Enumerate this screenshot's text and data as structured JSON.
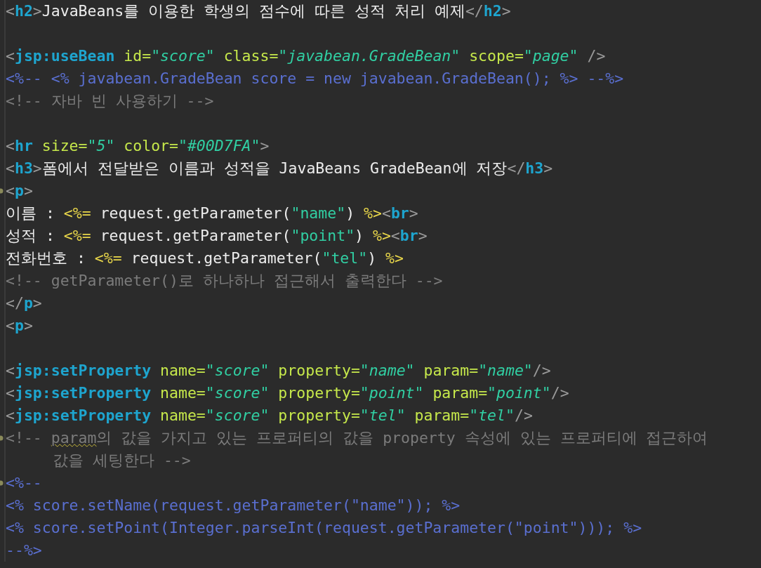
{
  "editor": {
    "lines": [
      {
        "kind": "code",
        "fold": false,
        "tokens": [
          {
            "text": "<",
            "kind": "p"
          },
          {
            "text": "h2",
            "kind": "tag"
          },
          {
            "text": ">",
            "kind": "p"
          },
          {
            "text": "JavaBeans를 이용한 학생의 점수에 따른 성적 처리 예제",
            "kind": "text"
          },
          {
            "text": "</",
            "kind": "p"
          },
          {
            "text": "h2",
            "kind": "tag"
          },
          {
            "text": ">",
            "kind": "p"
          }
        ]
      },
      {
        "kind": "blank"
      },
      {
        "kind": "code",
        "fold": false,
        "tokens": [
          {
            "text": "<",
            "kind": "p"
          },
          {
            "text": "jsp:useBean",
            "kind": "tag"
          },
          {
            "text": " id=",
            "kind": "attr"
          },
          {
            "text": "\"score\"",
            "kind": "val"
          },
          {
            "text": " class=",
            "kind": "attr"
          },
          {
            "text": "\"javabean.GradeBean\"",
            "kind": "val"
          },
          {
            "text": " scope=",
            "kind": "attr"
          },
          {
            "text": "\"page\"",
            "kind": "val"
          },
          {
            "text": " />",
            "kind": "p"
          }
        ]
      },
      {
        "kind": "code",
        "fold": false,
        "tokens": [
          {
            "text": "<%-- <% javabean.GradeBean score = new javabean.GradeBean(); %> --%>",
            "kind": "jspc"
          }
        ]
      },
      {
        "kind": "code",
        "fold": false,
        "tokens": [
          {
            "text": "<!-- 자바 빈 사용하기 -->",
            "kind": "cmt"
          }
        ]
      },
      {
        "kind": "blank"
      },
      {
        "kind": "code",
        "fold": false,
        "tokens": [
          {
            "text": "<",
            "kind": "p"
          },
          {
            "text": "hr",
            "kind": "tag"
          },
          {
            "text": " size=",
            "kind": "attr"
          },
          {
            "text": "\"5\"",
            "kind": "val"
          },
          {
            "text": " color=",
            "kind": "attr"
          },
          {
            "text": "\"#00D7FA\"",
            "kind": "val"
          },
          {
            "text": ">",
            "kind": "p"
          }
        ]
      },
      {
        "kind": "code",
        "fold": false,
        "tokens": [
          {
            "text": "<",
            "kind": "p"
          },
          {
            "text": "h3",
            "kind": "tag"
          },
          {
            "text": ">",
            "kind": "p"
          },
          {
            "text": "폼에서 전달받은 이름과 성적을 JavaBeans GradeBean에 저장",
            "kind": "text"
          },
          {
            "text": "</",
            "kind": "p"
          },
          {
            "text": "h3",
            "kind": "tag"
          },
          {
            "text": ">",
            "kind": "p"
          }
        ]
      },
      {
        "kind": "code",
        "fold": true,
        "tokens": [
          {
            "text": "<",
            "kind": "p"
          },
          {
            "text": "p",
            "kind": "tag"
          },
          {
            "text": ">",
            "kind": "p"
          }
        ]
      },
      {
        "kind": "code",
        "fold": false,
        "tokens": [
          {
            "text": "이름 : ",
            "kind": "text"
          },
          {
            "text": "<%=",
            "kind": "scr"
          },
          {
            "text": " request.getParameter(",
            "kind": "text"
          },
          {
            "text": "\"name\"",
            "kind": "str"
          },
          {
            "text": ") ",
            "kind": "text"
          },
          {
            "text": "%>",
            "kind": "scr"
          },
          {
            "text": "<",
            "kind": "p"
          },
          {
            "text": "br",
            "kind": "tag"
          },
          {
            "text": ">",
            "kind": "p"
          }
        ]
      },
      {
        "kind": "code",
        "fold": false,
        "tokens": [
          {
            "text": "성적 : ",
            "kind": "text"
          },
          {
            "text": "<%=",
            "kind": "scr"
          },
          {
            "text": " request.getParameter(",
            "kind": "text"
          },
          {
            "text": "\"point\"",
            "kind": "str"
          },
          {
            "text": ") ",
            "kind": "text"
          },
          {
            "text": "%>",
            "kind": "scr"
          },
          {
            "text": "<",
            "kind": "p"
          },
          {
            "text": "br",
            "kind": "tag"
          },
          {
            "text": ">",
            "kind": "p"
          }
        ]
      },
      {
        "kind": "code",
        "fold": false,
        "tokens": [
          {
            "text": "전화번호 : ",
            "kind": "text"
          },
          {
            "text": "<%=",
            "kind": "scr"
          },
          {
            "text": " request.getParameter(",
            "kind": "text"
          },
          {
            "text": "\"tel\"",
            "kind": "str"
          },
          {
            "text": ") ",
            "kind": "text"
          },
          {
            "text": "%>",
            "kind": "scr"
          }
        ]
      },
      {
        "kind": "code",
        "fold": false,
        "tokens": [
          {
            "text": "<!-- getParameter()로 하나하나 접근해서 출력한다 -->",
            "kind": "cmt"
          }
        ]
      },
      {
        "kind": "code",
        "fold": false,
        "tokens": [
          {
            "text": "</",
            "kind": "p"
          },
          {
            "text": "p",
            "kind": "tag"
          },
          {
            "text": ">",
            "kind": "p"
          }
        ]
      },
      {
        "kind": "code",
        "fold": false,
        "tokens": [
          {
            "text": "<",
            "kind": "p"
          },
          {
            "text": "p",
            "kind": "tag"
          },
          {
            "text": ">",
            "kind": "p"
          }
        ]
      },
      {
        "kind": "blank"
      },
      {
        "kind": "code",
        "fold": false,
        "tokens": [
          {
            "text": "<",
            "kind": "p"
          },
          {
            "text": "jsp:setProperty",
            "kind": "tag"
          },
          {
            "text": " name=",
            "kind": "attr"
          },
          {
            "text": "\"score\"",
            "kind": "val"
          },
          {
            "text": " property=",
            "kind": "attr"
          },
          {
            "text": "\"name\"",
            "kind": "val"
          },
          {
            "text": " param=",
            "kind": "attr"
          },
          {
            "text": "\"name\"",
            "kind": "val"
          },
          {
            "text": "/>",
            "kind": "p"
          }
        ]
      },
      {
        "kind": "code",
        "fold": false,
        "tokens": [
          {
            "text": "<",
            "kind": "p"
          },
          {
            "text": "jsp:setProperty",
            "kind": "tag"
          },
          {
            "text": " name=",
            "kind": "attr"
          },
          {
            "text": "\"score\"",
            "kind": "val"
          },
          {
            "text": " property=",
            "kind": "attr"
          },
          {
            "text": "\"point\"",
            "kind": "val"
          },
          {
            "text": " param=",
            "kind": "attr"
          },
          {
            "text": "\"point\"",
            "kind": "val"
          },
          {
            "text": "/>",
            "kind": "p"
          }
        ]
      },
      {
        "kind": "code",
        "fold": false,
        "tokens": [
          {
            "text": "<",
            "kind": "p"
          },
          {
            "text": "jsp:setProperty",
            "kind": "tag"
          },
          {
            "text": " name=",
            "kind": "attr"
          },
          {
            "text": "\"score\"",
            "kind": "val"
          },
          {
            "text": " property=",
            "kind": "attr"
          },
          {
            "text": "\"tel\"",
            "kind": "val"
          },
          {
            "text": " param=",
            "kind": "attr"
          },
          {
            "text": "\"tel\"",
            "kind": "val"
          },
          {
            "text": "/>",
            "kind": "p"
          }
        ]
      },
      {
        "kind": "code",
        "fold": true,
        "tokens": [
          {
            "text": "<!-- ",
            "kind": "cmt"
          },
          {
            "text": "param",
            "kind": "spell"
          },
          {
            "text": "의 값을 가지고 있는 프로퍼티의 값을 property 속성에 있는 프로퍼티에 접근하여",
            "kind": "cmt"
          }
        ]
      },
      {
        "kind": "wrap",
        "fold": false,
        "tokens": [
          {
            "text": "값을 세팅한다 -->",
            "kind": "cmt"
          }
        ]
      },
      {
        "kind": "code",
        "fold": true,
        "tokens": [
          {
            "text": "<%--",
            "kind": "jspc"
          }
        ]
      },
      {
        "kind": "code",
        "fold": false,
        "tokens": [
          {
            "text": "<% score.setName(request.getParameter(\"name\")); %>",
            "kind": "jspc"
          }
        ]
      },
      {
        "kind": "code",
        "fold": false,
        "tokens": [
          {
            "text": "<% score.setPoint(Integer.parseInt(request.getParameter(\"point\"))); %>",
            "kind": "jspc"
          }
        ]
      },
      {
        "kind": "code",
        "fold": false,
        "tokens": [
          {
            "text": "--%>",
            "kind": "jspc"
          }
        ]
      }
    ]
  }
}
